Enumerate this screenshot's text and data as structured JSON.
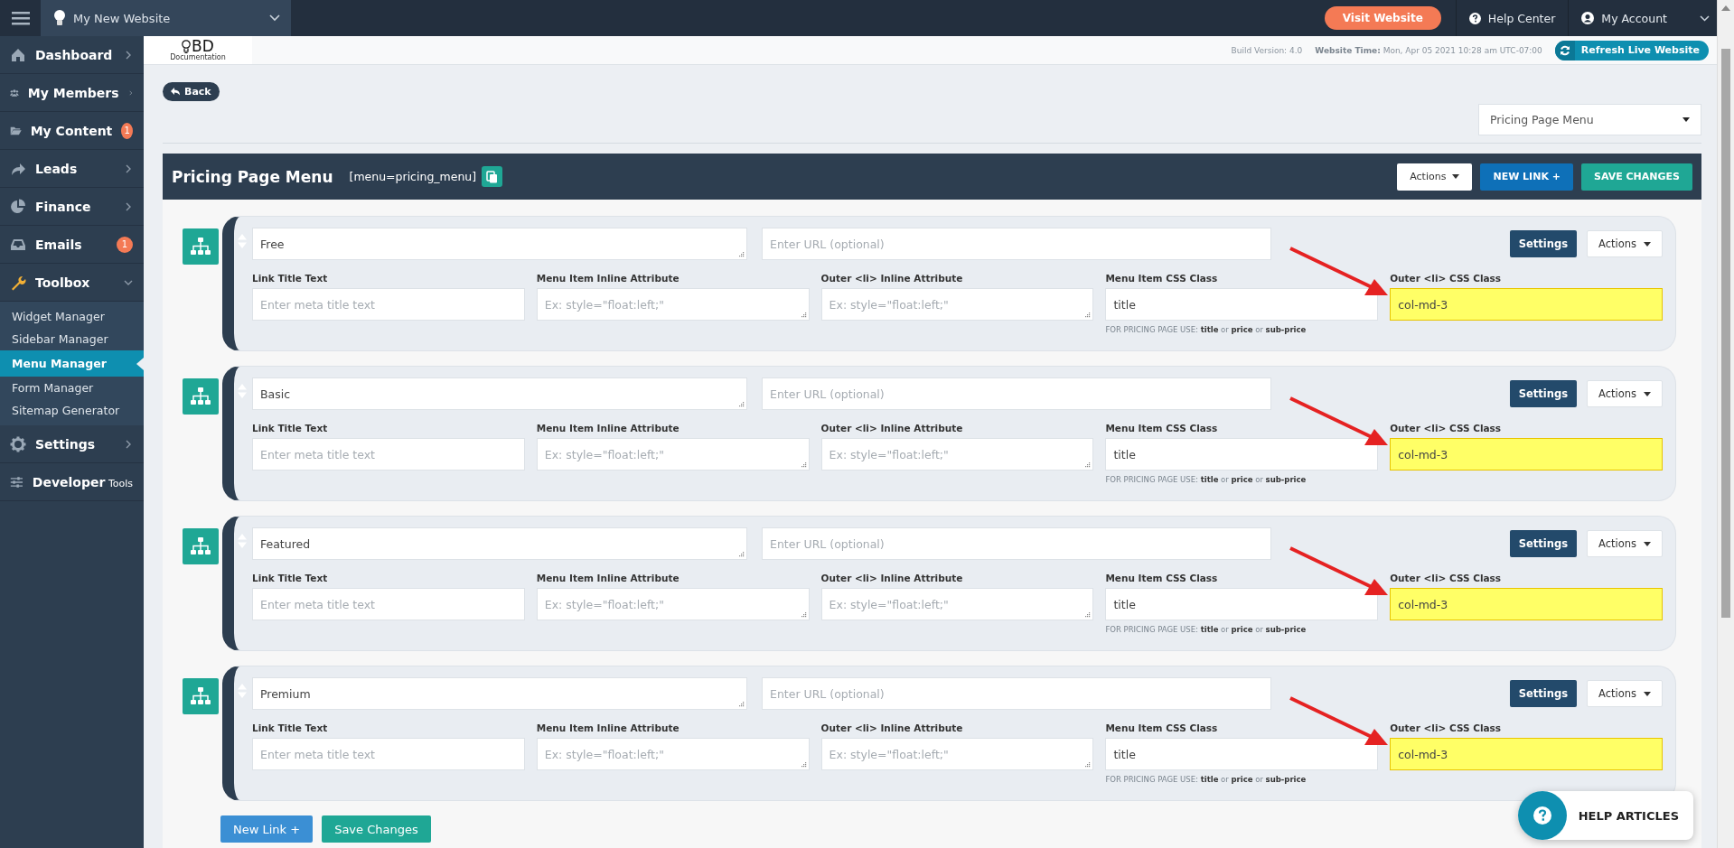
{
  "top_bar": {
    "site": "My New Website",
    "visit_button": "Visit Website",
    "help": "Help Center",
    "account": "My Account"
  },
  "sidebar": {
    "items": [
      {
        "label": "Dashboard",
        "expanded": false
      },
      {
        "label": "My Members",
        "expanded": false
      },
      {
        "label": "My Content",
        "badge": "1"
      },
      {
        "label": "Leads",
        "expanded": false
      },
      {
        "label": "Finance",
        "expanded": false
      },
      {
        "label": "Emails",
        "badge": "1"
      },
      {
        "label": "Toolbox",
        "expanded": true,
        "children": [
          {
            "label": "Widget Manager",
            "selected": false
          },
          {
            "label": "Sidebar Manager",
            "selected": false
          },
          {
            "label": "Menu Manager",
            "selected": true
          },
          {
            "label": "Form Manager",
            "selected": false
          },
          {
            "label": "Sitemap Generator",
            "selected": false
          }
        ]
      },
      {
        "label": "Settings",
        "expanded": false
      },
      {
        "label": "**Developer** Tools"
      }
    ]
  },
  "header_strip": {
    "logo_text": "BD",
    "logo_caption": "Documentation",
    "build": "Build Version: 4.0",
    "time_label": "Website Time:",
    "time_value": "Mon, Apr 05 2021 10:28 am UTC-07:00",
    "refresh_button": "Refresh Live Website"
  },
  "back_button": "Back",
  "menu_select": "Pricing Page Menu",
  "panel": {
    "title": "Pricing Page Menu",
    "shortcode": "[menu=pricing_menu]",
    "actions_button": "Actions",
    "new_link_button": "NEW LINK +",
    "save_button": "SAVE CHANGES"
  },
  "links": [
    {
      "name": "Free",
      "url_placeholder": "Enter URL (optional)",
      "settings_button": "Settings",
      "actions_button": "Actions",
      "fields": [
        {
          "label": "Link Title Text",
          "kind": "input",
          "placeholder": "Enter meta title text",
          "highlighted": false
        },
        {
          "label": "Menu Item Inline Attribute",
          "kind": "textarea",
          "placeholder": "Ex: style=\"float:left;\"",
          "highlighted": false
        },
        {
          "label": "Outer <li> Inline Attribute",
          "kind": "textarea",
          "placeholder": "Ex: style=\"float:left;\"",
          "highlighted": false
        },
        {
          "label": "Menu Item CSS Class",
          "kind": "input",
          "value": "title",
          "hint": "FOR PRICING PAGE USE: **title** or **price** or **sub-price**",
          "highlighted": false
        },
        {
          "label": "Outer <li> CSS Class",
          "kind": "input",
          "value": "col-md-3",
          "highlighted": true
        }
      ]
    },
    {
      "name": "Basic",
      "url_placeholder": "Enter URL (optional)",
      "settings_button": "Settings",
      "actions_button": "Actions",
      "fields": [
        {
          "label": "Link Title Text",
          "kind": "input",
          "placeholder": "Enter meta title text",
          "highlighted": false
        },
        {
          "label": "Menu Item Inline Attribute",
          "kind": "textarea",
          "placeholder": "Ex: style=\"float:left;\"",
          "highlighted": false
        },
        {
          "label": "Outer <li> Inline Attribute",
          "kind": "textarea",
          "placeholder": "Ex: style=\"float:left;\"",
          "highlighted": false
        },
        {
          "label": "Menu Item CSS Class",
          "kind": "input",
          "value": "title",
          "hint": "FOR PRICING PAGE USE: **title** or **price** or **sub-price**",
          "highlighted": false
        },
        {
          "label": "Outer <li> CSS Class",
          "kind": "input",
          "value": "col-md-3",
          "highlighted": true
        }
      ]
    },
    {
      "name": "Featured",
      "url_placeholder": "Enter URL (optional)",
      "settings_button": "Settings",
      "actions_button": "Actions",
      "fields": [
        {
          "label": "Link Title Text",
          "kind": "input",
          "placeholder": "Enter meta title text",
          "highlighted": false
        },
        {
          "label": "Menu Item Inline Attribute",
          "kind": "textarea",
          "placeholder": "Ex: style=\"float:left;\"",
          "highlighted": false
        },
        {
          "label": "Outer <li> Inline Attribute",
          "kind": "textarea",
          "placeholder": "Ex: style=\"float:left;\"",
          "highlighted": false
        },
        {
          "label": "Menu Item CSS Class",
          "kind": "input",
          "value": "title",
          "hint": "FOR PRICING PAGE USE: **title** or **price** or **sub-price**",
          "highlighted": false
        },
        {
          "label": "Outer <li> CSS Class",
          "kind": "input",
          "value": "col-md-3",
          "highlighted": true
        }
      ]
    },
    {
      "name": "Premium",
      "url_placeholder": "Enter URL (optional)",
      "settings_button": "Settings",
      "actions_button": "Actions",
      "fields": [
        {
          "label": "Link Title Text",
          "kind": "input",
          "placeholder": "Enter meta title text",
          "highlighted": false
        },
        {
          "label": "Menu Item Inline Attribute",
          "kind": "textarea",
          "placeholder": "Ex: style=\"float:left;\"",
          "highlighted": false
        },
        {
          "label": "Outer <li> Inline Attribute",
          "kind": "textarea",
          "placeholder": "Ex: style=\"float:left;\"",
          "highlighted": false
        },
        {
          "label": "Menu Item CSS Class",
          "kind": "input",
          "value": "title",
          "hint": "FOR PRICING PAGE USE: **title** or **price** or **sub-price**",
          "highlighted": false
        },
        {
          "label": "Outer <li> CSS Class",
          "kind": "input",
          "value": "col-md-3",
          "highlighted": true
        }
      ]
    }
  ],
  "footer_buttons": [
    {
      "label": "New Link +",
      "kind": "primary"
    },
    {
      "label": "Save Changes",
      "kind": "success"
    }
  ],
  "help_widget": "HELP ARTICLES"
}
